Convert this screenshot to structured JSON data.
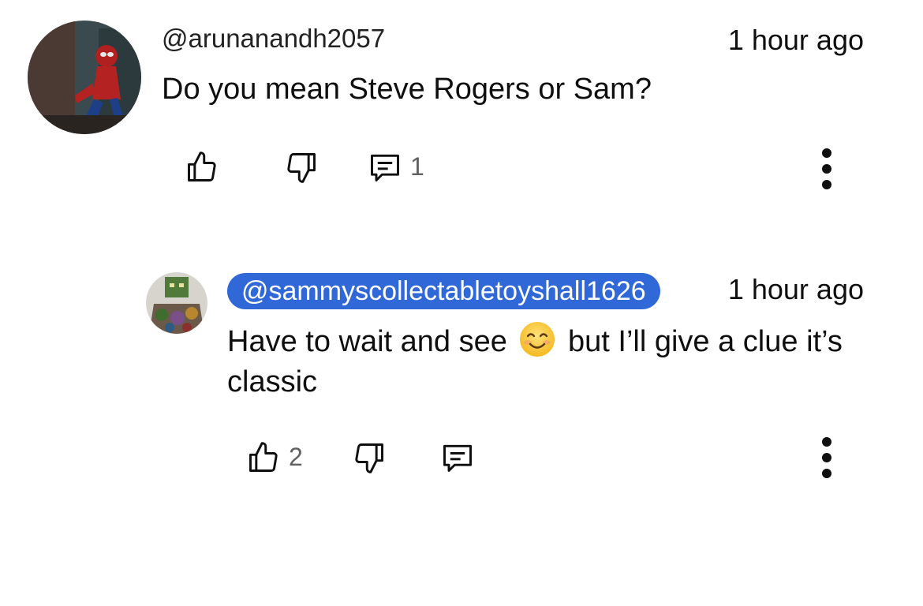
{
  "comment": {
    "author": "@arunanandh2057",
    "time": "1 hour ago",
    "text": "Do you mean Steve Rogers or Sam?",
    "reply_count": "1",
    "avatar_icon": "spider-man-avatar"
  },
  "reply": {
    "author": "@sammyscollectabletoyshall1626",
    "time": "1 hour ago",
    "text_before_emoji": "Have to wait and see",
    "emoji_icon": "smiling-face-emoji",
    "text_after_emoji": "but I’ll give a clue it’s classic",
    "like_count": "2",
    "avatar_icon": "collectible-figure-avatar",
    "author_highlight_color": "#3068d8"
  },
  "icons": {
    "like": "thumbs-up-icon",
    "dislike": "thumbs-down-icon",
    "reply": "reply-comment-icon",
    "more": "more-vertical-icon"
  }
}
